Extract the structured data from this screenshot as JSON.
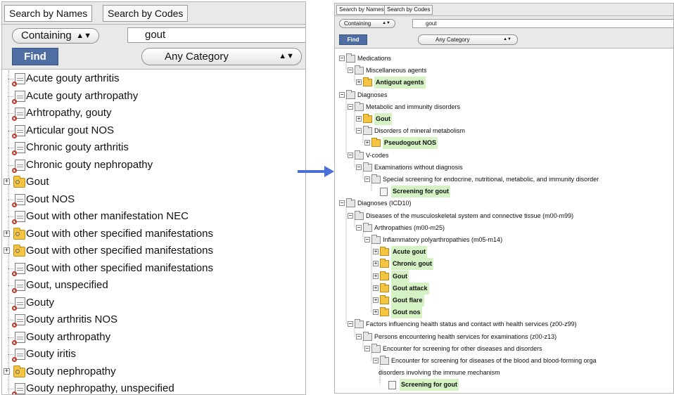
{
  "left_panel": {
    "tabs": [
      "Search by Names",
      "Search by Codes"
    ],
    "match_mode": "Containing",
    "query": "gout",
    "find_label": "Find",
    "category": "Any Category",
    "results": [
      {
        "label": "Acute gouty arthritis",
        "type": "leaf"
      },
      {
        "label": "Acute gouty arthropathy",
        "type": "leaf"
      },
      {
        "label": "Arhtropathy, gouty",
        "type": "leaf"
      },
      {
        "label": "Articular gout NOS",
        "type": "leaf"
      },
      {
        "label": "Chronic gouty arthritis",
        "type": "leaf"
      },
      {
        "label": "Chronic gouty nephropathy",
        "type": "leaf"
      },
      {
        "label": "Gout",
        "type": "folder"
      },
      {
        "label": "Gout NOS",
        "type": "leaf"
      },
      {
        "label": "Gout with other manifestation NEC",
        "type": "leaf"
      },
      {
        "label": "Gout with other specified manifestations",
        "type": "folder"
      },
      {
        "label": "Gout with other specified manifestations",
        "type": "folder"
      },
      {
        "label": "Gout with other specified manifestations",
        "type": "leaf"
      },
      {
        "label": "Gout, unspecified",
        "type": "leaf"
      },
      {
        "label": "Gouty",
        "type": "leaf"
      },
      {
        "label": "Gouty arthritis NOS",
        "type": "leaf"
      },
      {
        "label": "Gouty arthropathy",
        "type": "leaf"
      },
      {
        "label": "Gouty iritis",
        "type": "leaf"
      },
      {
        "label": "Gouty nephropathy",
        "type": "folder"
      },
      {
        "label": "Gouty nephropathy, unspecified",
        "type": "leaf"
      }
    ]
  },
  "right_panel": {
    "tabs": [
      "Search by Names",
      "Search by Codes"
    ],
    "match_mode": "Containing",
    "query": "gout",
    "find_label": "Find",
    "category": "Any Category",
    "tree": [
      {
        "label": "Medications",
        "depth": 0,
        "type": "folder",
        "highlight": false
      },
      {
        "label": "Miscellaneous agents",
        "depth": 1,
        "type": "folder",
        "highlight": false
      },
      {
        "label": "Antigout agents",
        "depth": 2,
        "type": "yfolder",
        "highlight": true
      },
      {
        "label": "Diagnoses",
        "depth": 0,
        "type": "folder",
        "highlight": false
      },
      {
        "label": "Metabolic and immunity disorders",
        "depth": 1,
        "type": "folder",
        "highlight": false
      },
      {
        "label": "Gout",
        "depth": 2,
        "type": "yfolder",
        "highlight": true
      },
      {
        "label": "Disorders of mineral metabolism",
        "depth": 2,
        "type": "folder",
        "highlight": false
      },
      {
        "label": "Pseudogout NOS",
        "depth": 3,
        "type": "yfolder",
        "highlight": true
      },
      {
        "label": "V-codes",
        "depth": 1,
        "type": "folder",
        "highlight": false
      },
      {
        "label": "Examinations without diagnosis",
        "depth": 2,
        "type": "folder",
        "highlight": false
      },
      {
        "label": "Special screening for endocrine, nutritional, metabolic, and immunity disorder",
        "depth": 3,
        "type": "folder",
        "highlight": false
      },
      {
        "label": "Screening for gout",
        "depth": 4,
        "type": "leaf",
        "highlight": true
      },
      {
        "label": "Diagnoses (ICD10)",
        "depth": 0,
        "type": "folder",
        "highlight": false
      },
      {
        "label": "Diseases of the musculoskeletal system and connective tissue (m00-m99)",
        "depth": 1,
        "type": "folder",
        "highlight": false
      },
      {
        "label": "Arthropathies (m00-m25)",
        "depth": 2,
        "type": "folder",
        "highlight": false
      },
      {
        "label": "Inflammatory polyarthropathies (m05-m14)",
        "depth": 3,
        "type": "folder",
        "highlight": false
      },
      {
        "label": "Acute gout",
        "depth": 4,
        "type": "yfolder",
        "highlight": true
      },
      {
        "label": "Chronic gout",
        "depth": 4,
        "type": "yfolder",
        "highlight": true
      },
      {
        "label": "Gout",
        "depth": 4,
        "type": "yfolder",
        "highlight": true
      },
      {
        "label": "Gout attack",
        "depth": 4,
        "type": "yfolder",
        "highlight": true
      },
      {
        "label": "Gout flare",
        "depth": 4,
        "type": "yfolder",
        "highlight": true
      },
      {
        "label": "Gout nos",
        "depth": 4,
        "type": "yfolder",
        "highlight": true
      },
      {
        "label": "Factors influencing health status and contact with health services (z00-z99)",
        "depth": 1,
        "type": "folder",
        "highlight": false
      },
      {
        "label": "Persons encountering health services for examinations (z00-z13)",
        "depth": 2,
        "type": "folder",
        "highlight": false
      },
      {
        "label": "Encounter for screening for other diseases and disorders",
        "depth": 3,
        "type": "folder",
        "highlight": false
      },
      {
        "label": "Encounter for screening for diseases of the blood and blood-forming orga",
        "depth": 4,
        "type": "folder",
        "highlight": false
      },
      {
        "label": "disorders involving the immune mechanism",
        "depth": 4,
        "type": "cont",
        "highlight": false
      },
      {
        "label": "Screening for gout",
        "depth": 5,
        "type": "leaf",
        "highlight": true
      }
    ]
  },
  "colors": {
    "find_button": "#4f6ea3",
    "highlight": "#d4f2c4",
    "folder": "#f5c542",
    "arrow": "#4a6fd8"
  }
}
